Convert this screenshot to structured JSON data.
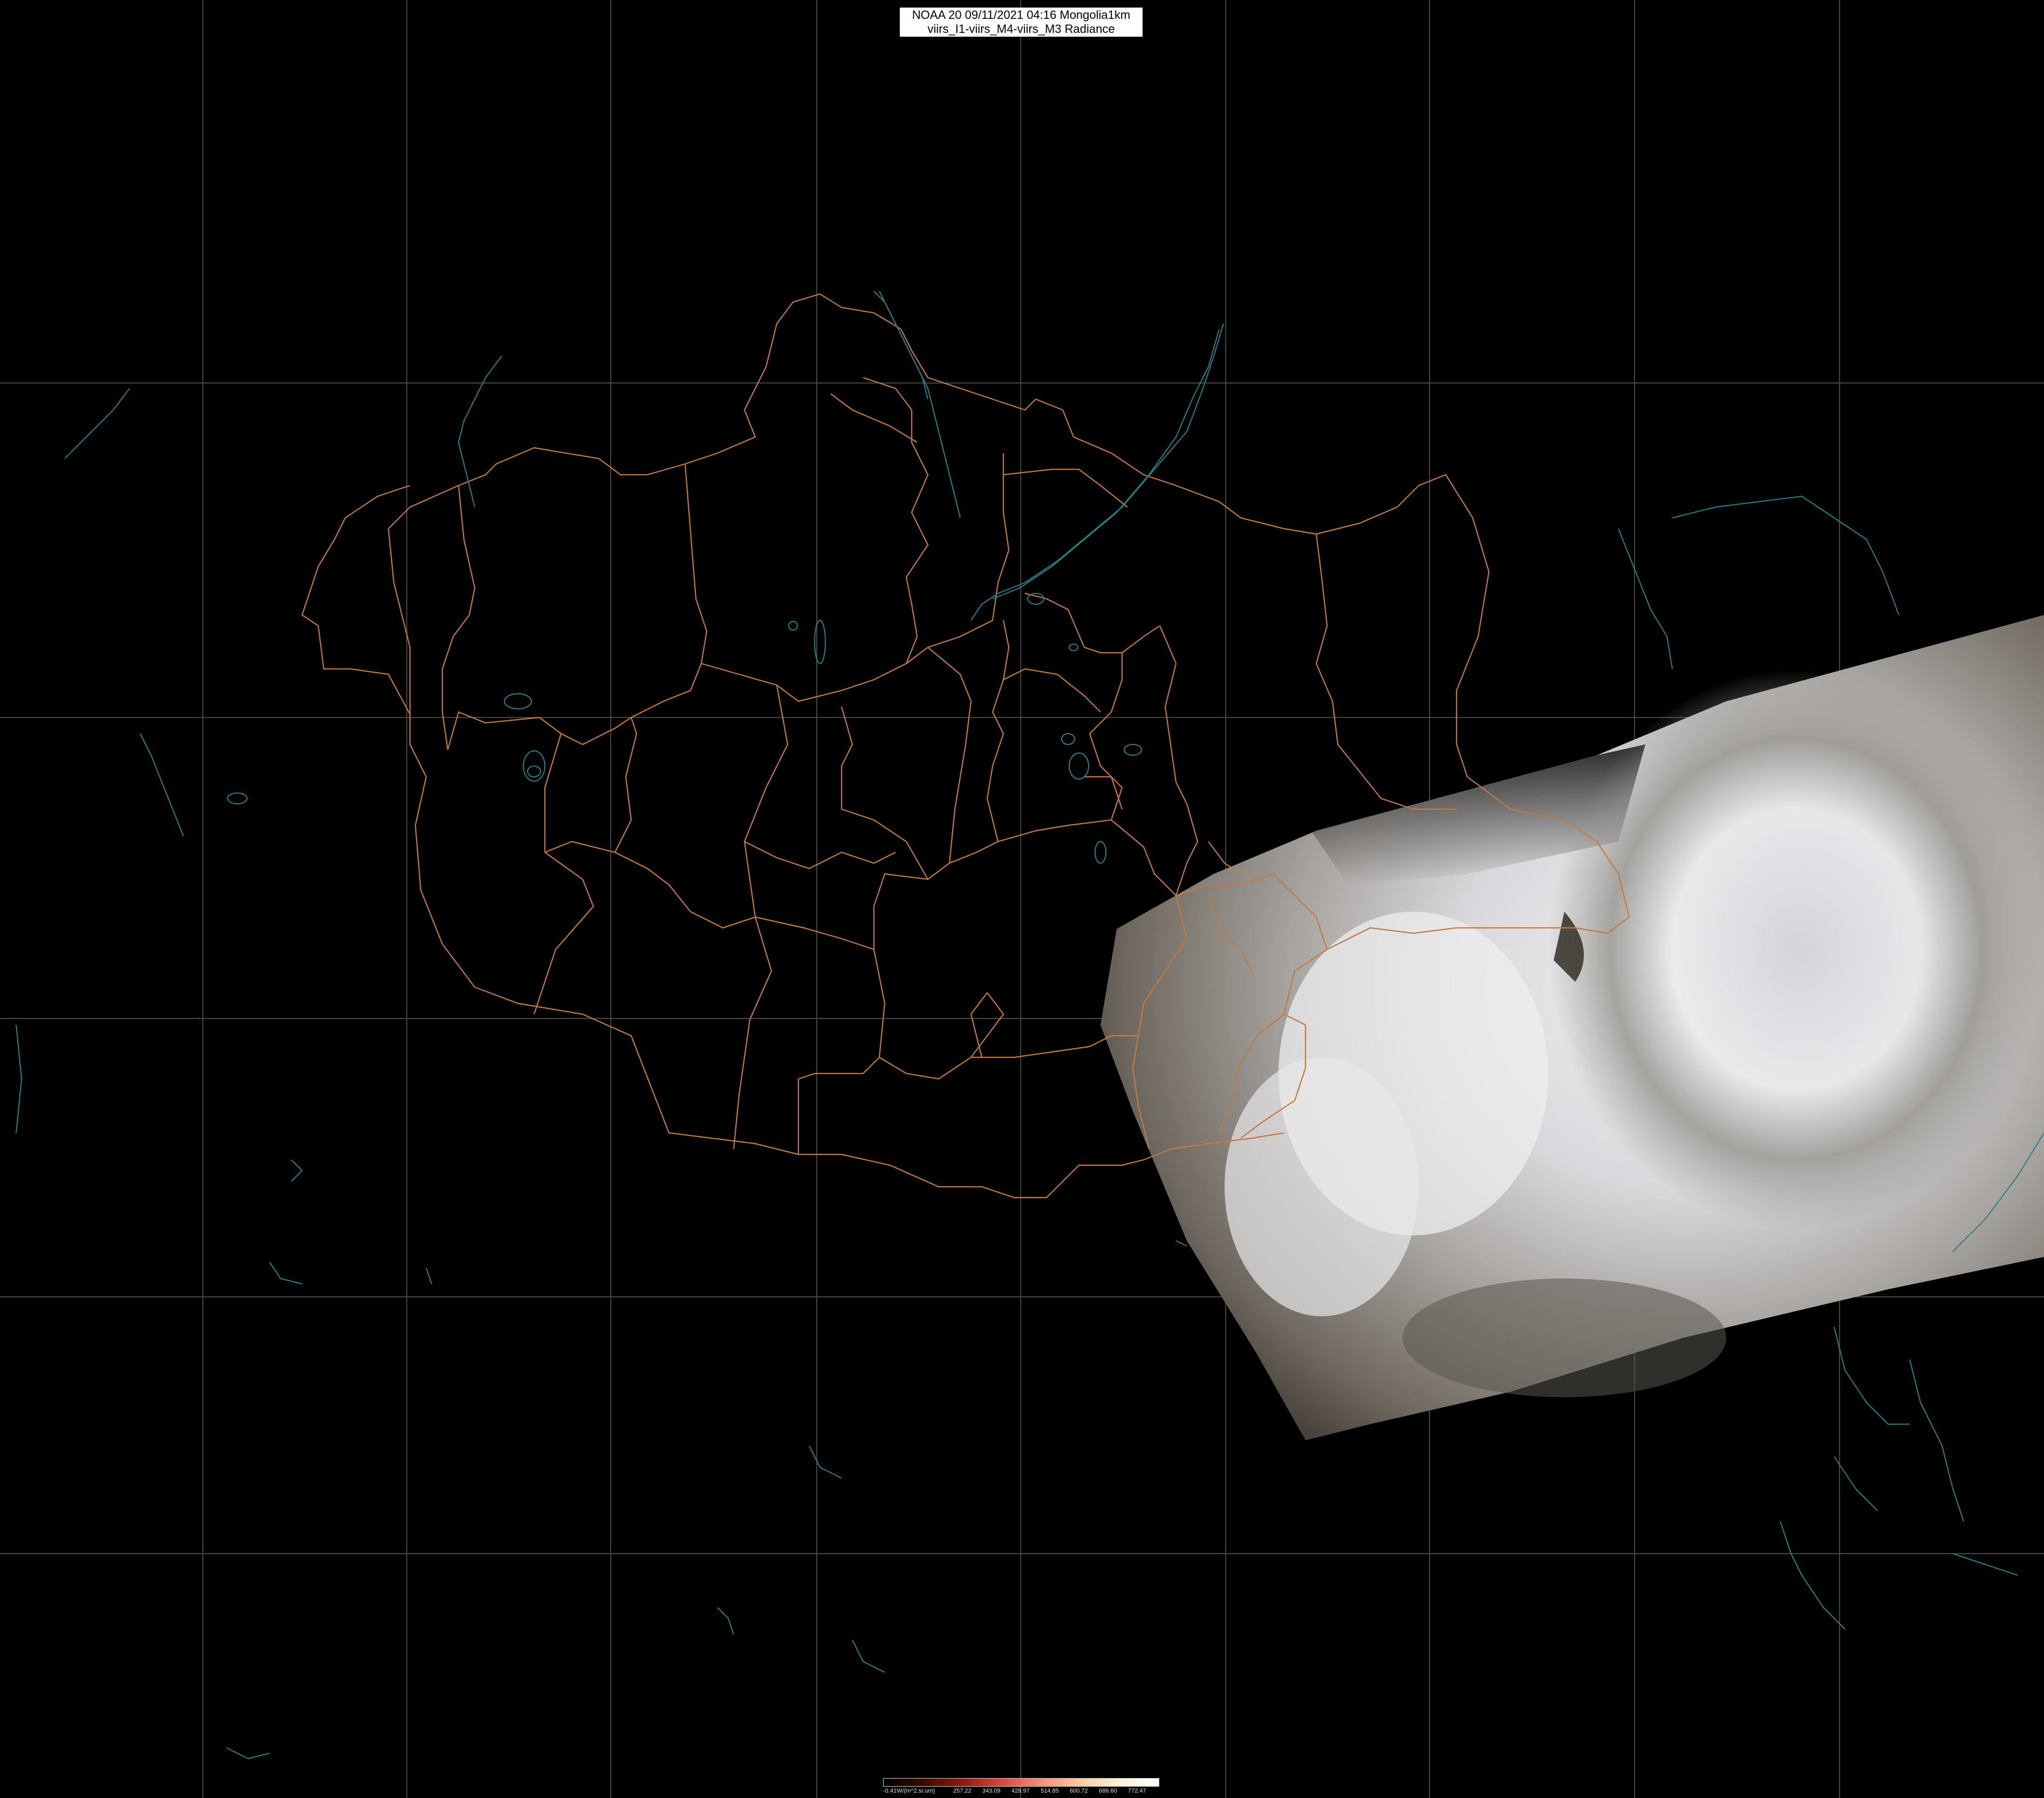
{
  "header": {
    "title_line1": "NOAA 20 09/11/2021 04:16 Mongolia1km",
    "title_line2": "viirs_I1-viirs_M4-viirs_M3 Radiance"
  },
  "colorbar": {
    "labels": [
      "-0.41W/(m^2.sr.um)",
      "257.22",
      "343.09",
      "428.97",
      "514.85",
      "600.72",
      "686.60",
      "772.47"
    ],
    "colors": [
      "#000000",
      "#3a0a06",
      "#8a1a10",
      "#d8473a",
      "#f28f7e",
      "#f7c9a2",
      "#fbf1d8",
      "#ffffff"
    ]
  },
  "map": {
    "border_color": "#c27a3f",
    "coast_color": "#2a7f8a",
    "grid_color": "#444444"
  }
}
